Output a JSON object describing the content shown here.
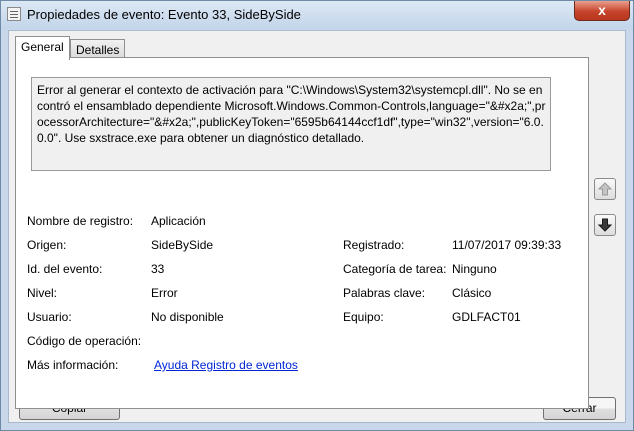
{
  "window": {
    "title": "Propiedades de evento: Evento 33, SideBySide",
    "close_label": "x"
  },
  "tabs": [
    {
      "label": "General",
      "active": true
    },
    {
      "label": "Detalles",
      "active": false
    }
  ],
  "description": "Error al generar el contexto de activación para \"C:\\Windows\\System32\\systemcpl.dll\". No se encontró el ensamblado dependiente Microsoft.Windows.Common-Controls,language=\"&#x2a;\",processorArchitecture=\"&#x2a;\",publicKeyToken=\"6595b64144ccf1df\",type=\"win32\",version=\"6.0.0.0\". Use sxstrace.exe para obtener un diagnóstico detallado.",
  "fields": {
    "log_name": {
      "label": "Nombre de registro:",
      "value": "Aplicación"
    },
    "source": {
      "label": "Origen:",
      "value": "SideBySide"
    },
    "logged": {
      "label": "Registrado:",
      "value": "11/07/2017 09:39:33"
    },
    "event_id": {
      "label": "Id. del evento:",
      "value": "33"
    },
    "task_category": {
      "label": "Categoría de tarea:",
      "value": "Ninguno"
    },
    "level": {
      "label": "Nivel:",
      "value": "Error"
    },
    "keywords": {
      "label": "Palabras clave:",
      "value": "Clásico"
    },
    "user": {
      "label": "Usuario:",
      "value": "No disponible"
    },
    "computer": {
      "label": "Equipo:",
      "value": "GDLFACT01"
    },
    "op_code": {
      "label": "Código de operación:",
      "value": ""
    },
    "more_info": {
      "label": "Más información:",
      "link": "Ayuda Registro de eventos"
    }
  },
  "buttons": {
    "copy": "Copiar",
    "close": "Cerrar"
  },
  "icons": {
    "scroll_up": "arrow-up-icon",
    "scroll_down": "arrow-down-icon"
  }
}
